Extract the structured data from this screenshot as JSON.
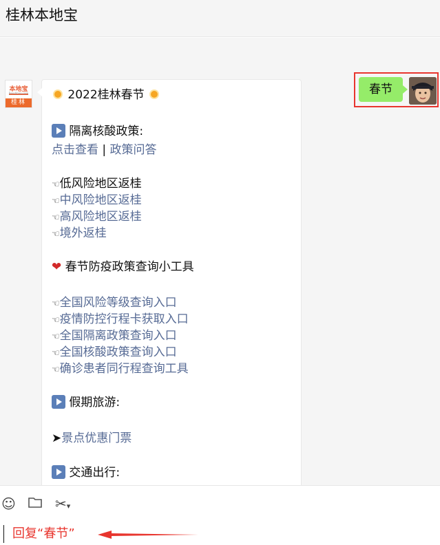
{
  "header": {
    "title": "桂林本地宝"
  },
  "outgoing": {
    "text": "春节"
  },
  "bot": {
    "logo_text": "本地宝",
    "logo_url": "Bendibao.com",
    "city": "桂林"
  },
  "message": {
    "title": "2022桂林春节",
    "section1_title": "隔离核酸政策:",
    "link_view": "点击查看",
    "separator": "|",
    "link_faq": "政策问答",
    "low_risk": "低风险地区返桂",
    "mid_risk": "中风险地区返桂",
    "high_risk": "高风险地区返桂",
    "overseas": "境外返桂",
    "tools_title": "春节防疫政策查询小工具",
    "tools": [
      "全国风险等级查询入口",
      "疫情防控行程卡获取入口",
      "全国隔离政策查询入口",
      "全国核酸政策查询入口",
      "确诊患者同行程查询工具"
    ],
    "holiday_title": "假期旅游:",
    "tickets": "景点优惠门票",
    "transport_title": "交通出行:"
  },
  "toolbar": {
    "emoji_icon": "smiley-icon",
    "folder_icon": "folder-icon",
    "scissors_icon": "scissors-icon",
    "hint": "回复“春节”"
  },
  "colors": {
    "link": "#576b95",
    "highlight": "#e8352e",
    "bubble_green": "#95ec69"
  }
}
